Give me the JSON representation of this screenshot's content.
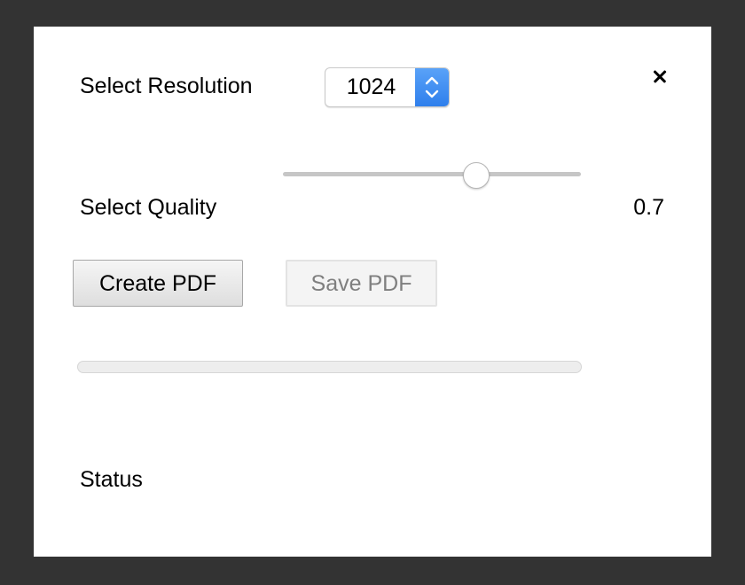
{
  "resolution": {
    "label": "Select Resolution",
    "selected_value": "1024"
  },
  "quality": {
    "label": "Select Quality",
    "value_text": "0.7",
    "slider_fraction": 0.65
  },
  "buttons": {
    "create_label": "Create PDF",
    "save_label": "Save PDF",
    "save_enabled": false
  },
  "progress": {
    "fraction": 0
  },
  "status": {
    "label": "Status"
  },
  "icons": {
    "close": "close-icon",
    "select_arrows": "chevron-up-down-icon"
  },
  "colors": {
    "accent": "#3b86f0",
    "background": "#333333",
    "panel": "#ffffff"
  }
}
